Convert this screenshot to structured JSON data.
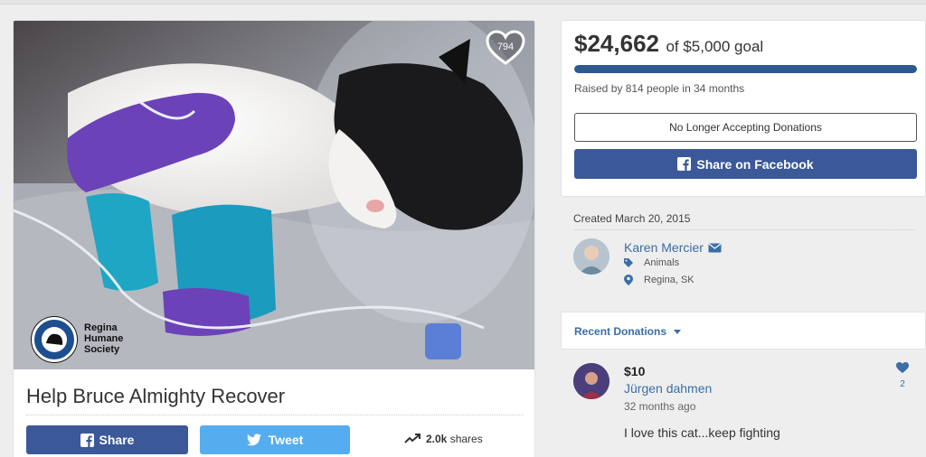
{
  "campaign": {
    "title": "Help Bruce Almighty Recover",
    "hearts": "794",
    "logo_text": [
      "Regina",
      "Humane",
      "Society"
    ]
  },
  "social": {
    "share_label": "Share",
    "tweet_label": "Tweet",
    "shares_count": "2.0k",
    "shares_label": "shares"
  },
  "donate": {
    "amount": "$24,662",
    "goal_text": "of $5,000 goal",
    "progress_fraction": 1.0,
    "raised_text": "Raised by 814 people in 34 months",
    "closed_label": "No Longer Accepting Donations",
    "facebook_label": "Share on Facebook"
  },
  "meta": {
    "created": "Created March 20, 2015",
    "organizer": "Karen Mercier",
    "category": "Animals",
    "location": "Regina, SK"
  },
  "recent": {
    "title": "Recent Donations"
  },
  "donation": {
    "amount": "$10",
    "name": "Jürgen dahmen",
    "time": "32 months ago",
    "message": "I love this cat...keep fighting",
    "likes": "2"
  },
  "colors": {
    "facebook": "#3b5998",
    "twitter": "#55acee",
    "link": "#3a6ea5",
    "progress": "#2c5a8c"
  },
  "icons": [
    "heart-icon",
    "facebook-icon",
    "twitter-icon",
    "trending-icon",
    "envelope-icon",
    "tag-icon",
    "map-pin-icon",
    "caret-down-icon"
  ]
}
